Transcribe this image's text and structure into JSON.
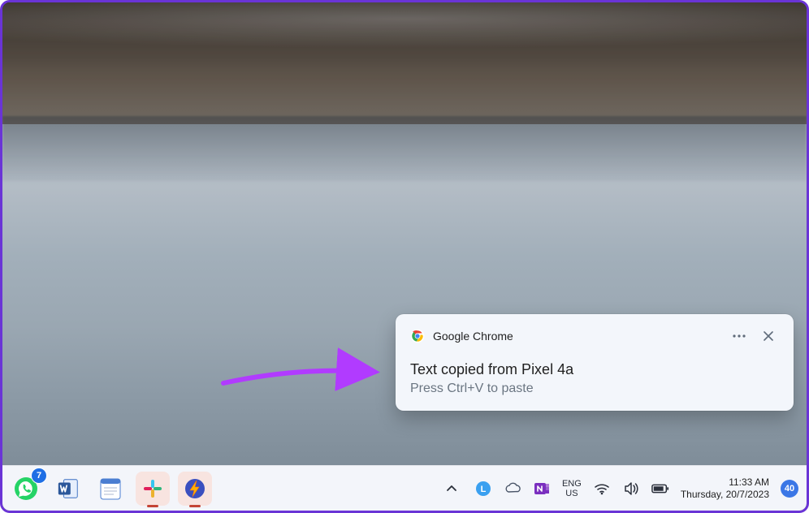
{
  "notification": {
    "app_name": "Google Chrome",
    "title": "Text copied from Pixel 4a",
    "subtitle": "Press Ctrl+V to paste"
  },
  "taskbar": {
    "whatsapp_badge": "7",
    "lang_top": "ENG",
    "lang_bottom": "US",
    "clock_time": "11:33 AM",
    "clock_date": "Thursday, 20/7/2023",
    "notif_count": "40"
  }
}
